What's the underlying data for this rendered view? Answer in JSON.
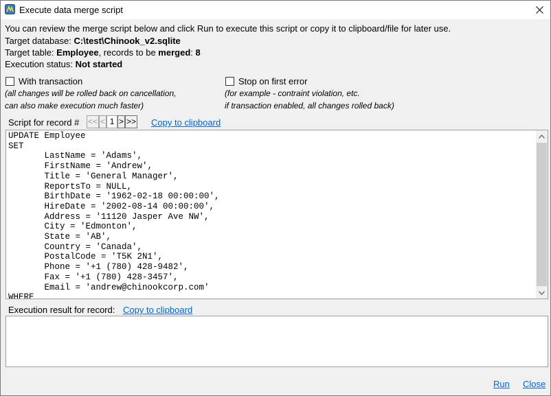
{
  "window": {
    "title": "Execute data merge script"
  },
  "info": {
    "intro": "You can review the merge script below and click Run to execute this script or copy it to clipboard/file for later use.",
    "target_db_label": "Target database: ",
    "target_db_value": "C:\\test\\Chinook_v2.sqlite",
    "target_table_label": "Target table: ",
    "target_table_value": "Employee",
    "records_label": ", records to be ",
    "records_bold": "merged",
    "records_colon": ": ",
    "records_count": "8",
    "status_label": "Execution status: ",
    "status_value": "Not started"
  },
  "options": {
    "with_transaction": {
      "label": "With transaction",
      "checked": false,
      "note1": "(all changes will be rolled back on cancellation,",
      "note2": " can also make execution much faster)"
    },
    "stop_on_error": {
      "label": "Stop on first error",
      "checked": false,
      "note1": "(for example - contraint violation, etc.",
      "note2": " if transaction enabled, all changes rolled back)"
    }
  },
  "script_nav": {
    "label": "Script for record #",
    "first": "<<",
    "prev": "<",
    "current": "1",
    "next": ">",
    "last": ">>",
    "copy_link": "Copy to clipboard"
  },
  "script_lines": [
    "UPDATE Employee",
    "SET",
    "       LastName = 'Adams',",
    "       FirstName = 'Andrew',",
    "       Title = 'General Manager',",
    "       ReportsTo = NULL,",
    "       BirthDate = '1962-02-18 00:00:00',",
    "       HireDate = '2002-08-14 00:00:00',",
    "       Address = '11120 Jasper Ave NW',",
    "       City = 'Edmonton',",
    "       State = 'AB',",
    "       Country = 'Canada',",
    "       PostalCode = 'T5K 2N1',",
    "       Phone = '+1 (780) 428-9482',",
    "       Fax = '+1 (780) 428-3457',",
    "       Email = 'andrew@chinookcorp.com'",
    "WHERE"
  ],
  "result": {
    "label": "Execution result for record:",
    "copy_link": "Copy to clipboard",
    "text": ""
  },
  "footer": {
    "run": "Run",
    "close": "Close"
  }
}
